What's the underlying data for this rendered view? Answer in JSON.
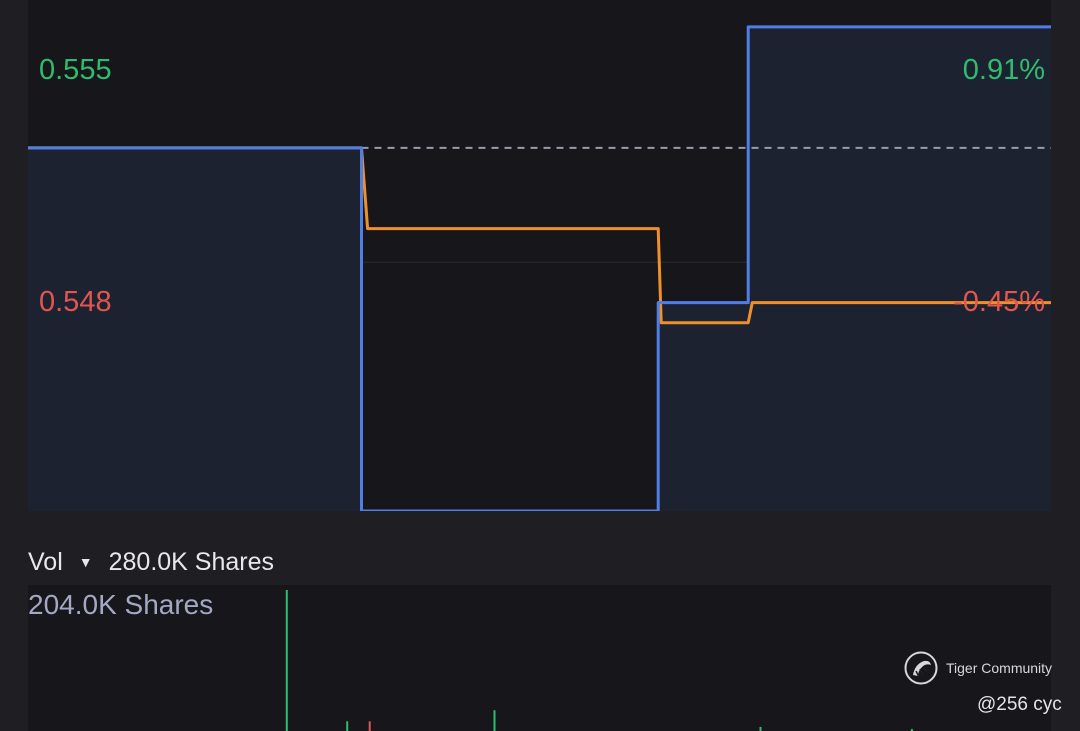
{
  "chart_data": {
    "type": "line",
    "price_axis": {
      "top_label": "0.555",
      "bottom_label": "0.548",
      "top_pct": "0.91%",
      "bottom_pct": "-0.45%",
      "top_value": 0.555,
      "bottom_value": 0.548,
      "reference_value": 0.5514
    },
    "ylim": [
      0.5406,
      0.5558
    ],
    "x_range": [
      0,
      100
    ],
    "series": [
      {
        "color": "#4f7fe6",
        "points": [
          [
            0,
            0.5514
          ],
          [
            32.6,
            0.5514
          ],
          [
            32.6,
            0.5406
          ],
          [
            61.6,
            0.5406
          ],
          [
            61.6,
            0.5468
          ],
          [
            70.4,
            0.5468
          ],
          [
            70.4,
            0.555
          ],
          [
            100,
            0.555
          ]
        ]
      },
      {
        "color": "#f0902a",
        "points": [
          [
            0,
            0.5514
          ],
          [
            32.6,
            0.5514
          ],
          [
            33.2,
            0.549
          ],
          [
            61.6,
            0.549
          ],
          [
            61.9,
            0.5462
          ],
          [
            70.4,
            0.5462
          ],
          [
            70.8,
            0.5468
          ],
          [
            100,
            0.5468
          ]
        ]
      }
    ],
    "grid": true
  },
  "volume": {
    "label": "Vol",
    "current": "280.0K Shares",
    "max_label": "204.0K Shares",
    "max_value": 204000,
    "bars": [
      {
        "x": 25.3,
        "value": 204000,
        "color": "#2ebd6f"
      },
      {
        "x": 31.2,
        "value": 14000,
        "color": "#2ebd6f"
      },
      {
        "x": 33.4,
        "value": 14000,
        "color": "#e25651"
      },
      {
        "x": 45.6,
        "value": 30000,
        "color": "#2ebd6f"
      },
      {
        "x": 71.6,
        "value": 6000,
        "color": "#2ebd6f"
      },
      {
        "x": 86.4,
        "value": 3000,
        "color": "#2ebd6f"
      }
    ]
  },
  "colors": {
    "up": "#2ebd6f",
    "down": "#e25651",
    "line_primary": "#4f7fe6",
    "line_avg": "#f0902a"
  },
  "watermark": {
    "text": "Tiger Community",
    "user": "@256 cyc",
    "icon": "tiger-logo-icon"
  }
}
